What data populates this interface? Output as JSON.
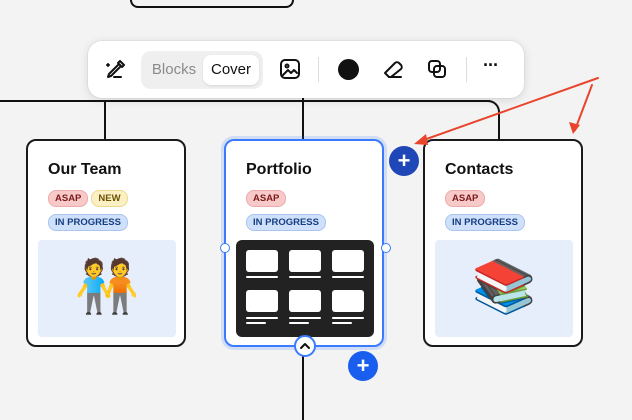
{
  "toolbar": {
    "segments": {
      "blocks": "Blocks",
      "cover": "Cover",
      "active": "cover"
    },
    "icons": [
      "magic-edit-icon",
      "image-icon",
      "color-dot-icon",
      "eraser-icon",
      "duplicate-icon",
      "more-icon"
    ],
    "more_label": "···"
  },
  "cards": [
    {
      "title": "Our Team",
      "tags": [
        {
          "label": "ASAP",
          "color": "red"
        },
        {
          "label": "NEW",
          "color": "yellow"
        },
        {
          "label": "IN PROGRESS",
          "color": "blue"
        }
      ],
      "cover_emoji": "🧑‍🤝‍🧑"
    },
    {
      "title": "Portfolio",
      "selected": true,
      "tags": [
        {
          "label": "ASAP",
          "color": "red"
        },
        {
          "label": "IN PROGRESS",
          "color": "blue"
        }
      ],
      "cover_type": "blocks"
    },
    {
      "title": "Contacts",
      "tags": [
        {
          "label": "ASAP",
          "color": "red"
        },
        {
          "label": "IN PROGRESS",
          "color": "blue"
        }
      ],
      "cover_emoji": "📚"
    }
  ],
  "actions": {
    "add_sibling": "+",
    "add_child": "+"
  },
  "colors": {
    "accent": "#3a7bff",
    "add_button_dark": "#1f47b8",
    "add_button": "#1a5ef0",
    "arrow": "#e8452c"
  }
}
